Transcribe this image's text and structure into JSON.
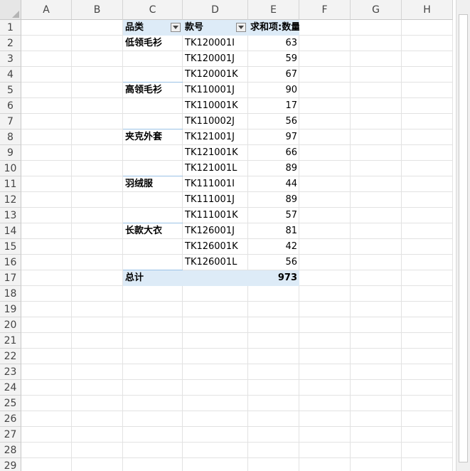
{
  "columns": [
    "A",
    "B",
    "C",
    "D",
    "E",
    "F",
    "G",
    "H"
  ],
  "rows": [
    "1",
    "2",
    "3",
    "4",
    "5",
    "6",
    "7",
    "8",
    "9",
    "10",
    "11",
    "12",
    "13",
    "14",
    "15",
    "16",
    "17",
    "18",
    "19",
    "20",
    "21",
    "22",
    "23",
    "24",
    "25",
    "26",
    "27",
    "28",
    "29"
  ],
  "pivot": {
    "header": {
      "category": "品类",
      "style": "款号",
      "sum": "求和项:数量"
    },
    "groups": [
      {
        "name": "低领毛衫",
        "items": [
          {
            "code": "TK120001I",
            "qty": "63"
          },
          {
            "code": "TK120001J",
            "qty": "59"
          },
          {
            "code": "TK120001K",
            "qty": "67"
          }
        ]
      },
      {
        "name": "高领毛衫",
        "items": [
          {
            "code": "TK110001J",
            "qty": "90"
          },
          {
            "code": "TK110001K",
            "qty": "17"
          },
          {
            "code": "TK110002J",
            "qty": "56"
          }
        ]
      },
      {
        "name": "夹克外套",
        "items": [
          {
            "code": "TK121001J",
            "qty": "97"
          },
          {
            "code": "TK121001K",
            "qty": "66"
          },
          {
            "code": "TK121001L",
            "qty": "89"
          }
        ]
      },
      {
        "name": "羽绒服",
        "items": [
          {
            "code": "TK111001I",
            "qty": "44"
          },
          {
            "code": "TK111001J",
            "qty": "89"
          },
          {
            "code": "TK111001K",
            "qty": "57"
          }
        ]
      },
      {
        "name": "长款大衣",
        "items": [
          {
            "code": "TK126001J",
            "qty": "81"
          },
          {
            "code": "TK126001K",
            "qty": "42"
          },
          {
            "code": "TK126001L",
            "qty": "56"
          }
        ]
      }
    ],
    "total": {
      "label": "总计",
      "value": "973"
    }
  },
  "colors": {
    "pivot_fill": "#ddebf7",
    "group_line": "#9bc2e6",
    "selected_header": "#217346"
  }
}
